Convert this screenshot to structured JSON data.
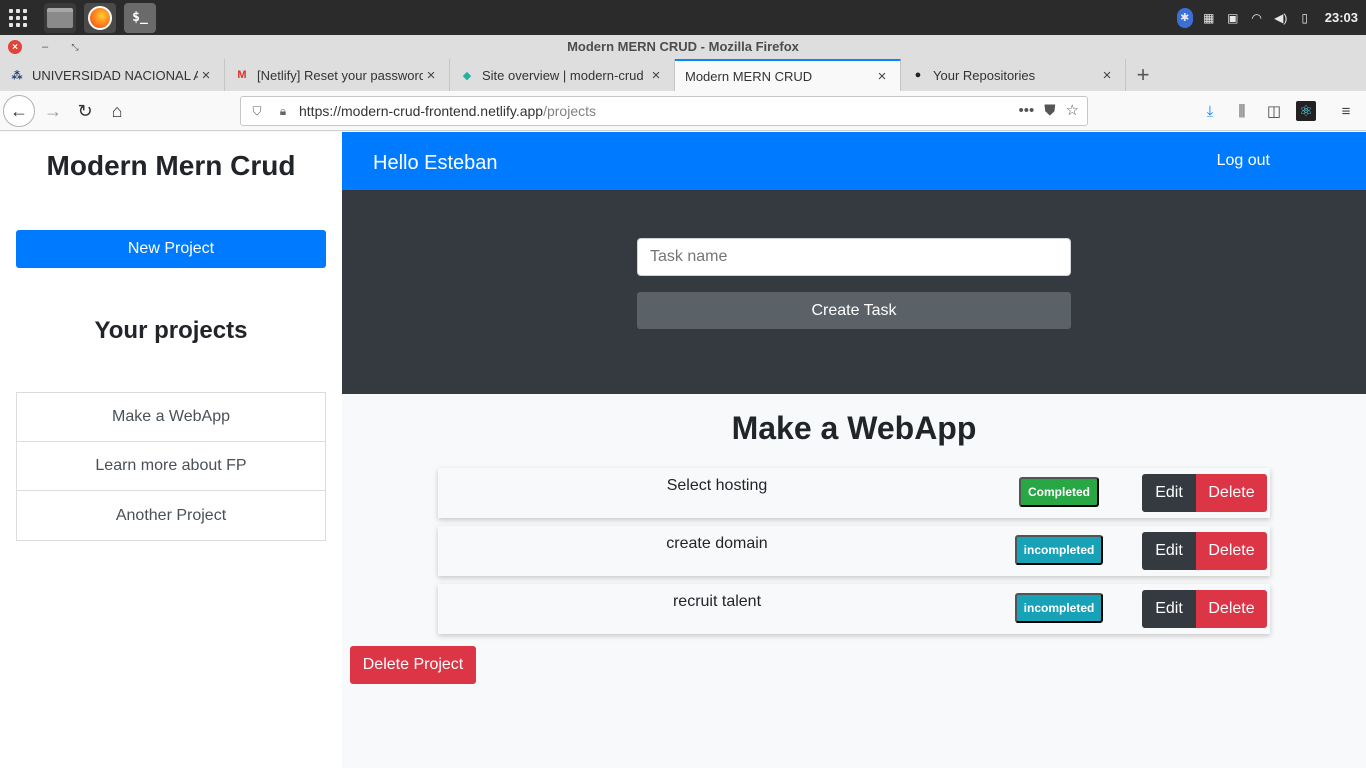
{
  "os": {
    "launcher_icon": "app-grid-icon",
    "apps": [
      "files-icon",
      "firefox-icon",
      "terminal-icon"
    ],
    "terminal_label": "$_",
    "clock": "23:03"
  },
  "browser": {
    "window_title": "Modern MERN CRUD - Mozilla Firefox",
    "tabs": [
      {
        "label": "UNIVERSIDAD NACIONAL AUTÓNOMA",
        "active": false
      },
      {
        "label": "[Netlify] Reset your password",
        "active": false
      },
      {
        "label": "Site overview | modern-crud",
        "active": false
      },
      {
        "label": "Modern MERN CRUD",
        "active": true
      },
      {
        "label": "Your Repositories",
        "active": false
      }
    ],
    "url_host": "https://modern-crud-frontend.netlify.app",
    "url_path": "/projects"
  },
  "sidebar": {
    "brand": "Modern Mern Crud",
    "new_project_label": "New Project",
    "projects_heading": "Your projects",
    "projects": [
      "Make a WebApp",
      "Learn more about FP",
      "Another Project"
    ]
  },
  "header": {
    "greeting": "Hello Esteban",
    "logout_label": "Log out"
  },
  "task_form": {
    "placeholder": "Task name",
    "submit_label": "Create Task"
  },
  "project": {
    "title": "Make a WebApp",
    "tasks": [
      {
        "name": "Select hosting",
        "status": "Completed",
        "edit": "Edit",
        "delete": "Delete"
      },
      {
        "name": "create domain",
        "status": "incompleted",
        "edit": "Edit",
        "delete": "Delete"
      },
      {
        "name": "recruit talent",
        "status": "incompleted",
        "edit": "Edit",
        "delete": "Delete"
      }
    ],
    "delete_project_label": "Delete Project"
  },
  "colors": {
    "primary": "#007bff",
    "dark": "#343a40",
    "danger": "#dc3545",
    "success": "#28a745",
    "info": "#17a2b8"
  }
}
